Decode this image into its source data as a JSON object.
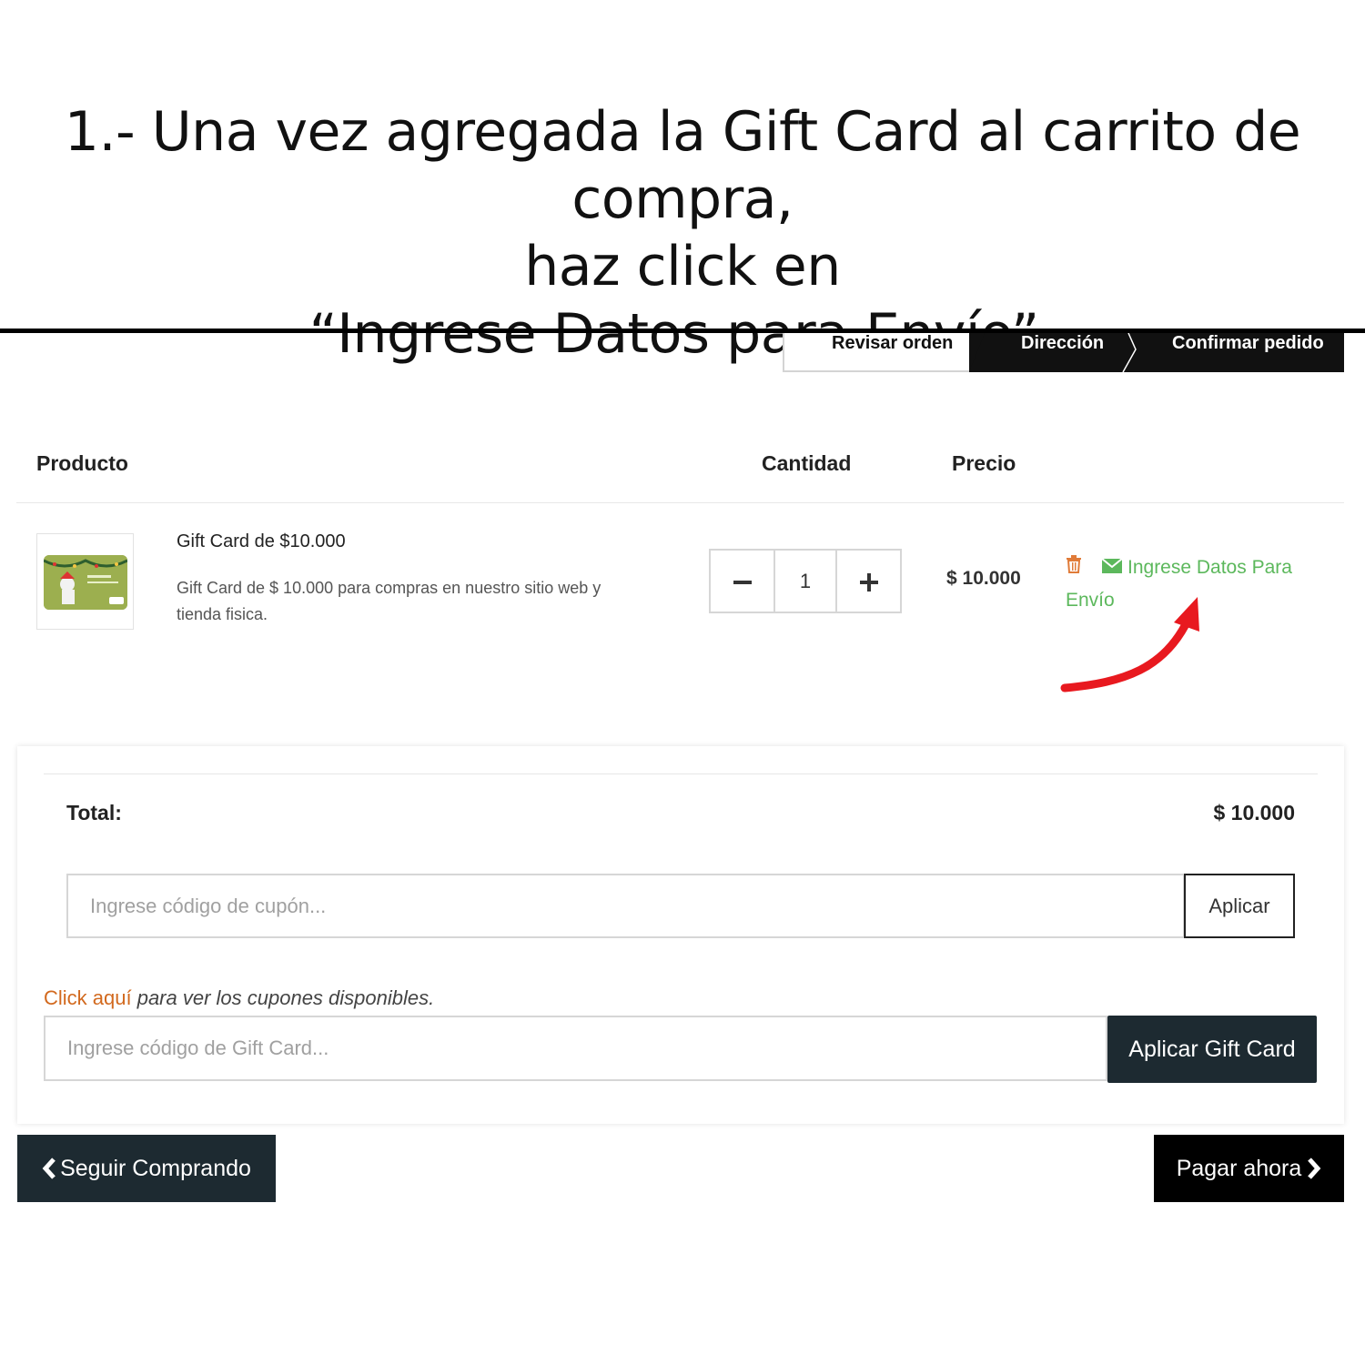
{
  "instruction": {
    "line1": "1.- Una vez agregada la Gift Card al carrito de compra,",
    "line2": "haz click en",
    "line3": "“Ingrese Datos para Envío”."
  },
  "steps": {
    "review": "Revisar orden",
    "address": "Dirección",
    "confirm": "Confirmar pedido"
  },
  "table": {
    "headers": {
      "product": "Producto",
      "quantity": "Cantidad",
      "price": "Precio"
    }
  },
  "cart_item": {
    "name": "Gift Card de $10.000",
    "description": "Gift Card de $ 10.000 para compras en nuestro sitio web y tienda fisica.",
    "quantity": "1",
    "price": "$ 10.000",
    "shipping_link": "Ingrese Datos Para Envío",
    "icons": {
      "delete": "trash-icon",
      "shipping": "envelope-icon",
      "minus": "minus-icon",
      "plus": "plus-icon"
    }
  },
  "summary": {
    "total_label": "Total:",
    "total_value": "$ 10.000",
    "coupon_placeholder": "Ingrese código de cupón...",
    "coupon_button": "Aplicar",
    "coupons_link": "Click aquí",
    "coupons_note": " para ver los cupones disponibles.",
    "giftcard_placeholder": "Ingrese código de Gift Card...",
    "giftcard_button": "Aplicar Gift Card"
  },
  "nav": {
    "continue": "Seguir Comprando",
    "pay": "Pagar ahora"
  },
  "colors": {
    "dark_button": "#1d2a31",
    "link_green": "#5cb85c",
    "coupon_link": "#d2691e",
    "delete_icon": "#e07b39",
    "arrow": "#e8191f"
  }
}
